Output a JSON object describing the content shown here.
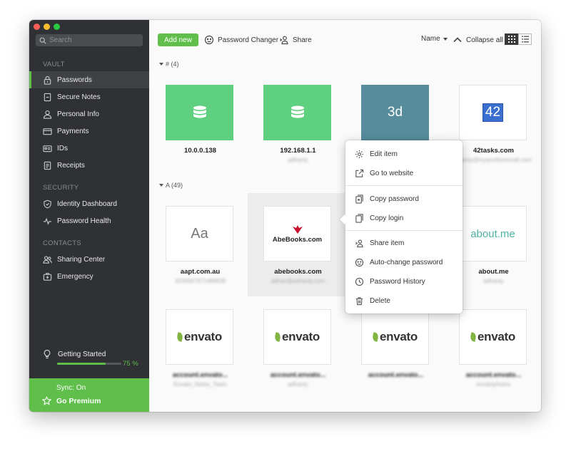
{
  "colors": {
    "accent": "#5fbf4a",
    "sidebar": "#2f3134",
    "tile_green": "#5fcf80",
    "tile_teal": "#568c9b",
    "tile_blue": "#3a6fd0",
    "about_me": "#4fb3a4",
    "abebooks_red": "#c8102e"
  },
  "sidebar": {
    "search_placeholder": "Search",
    "vault_header": "VAULT",
    "vault_items": [
      {
        "label": "Passwords",
        "icon": "lock-icon"
      },
      {
        "label": "Secure Notes",
        "icon": "note-icon"
      },
      {
        "label": "Personal Info",
        "icon": "person-icon"
      },
      {
        "label": "Payments",
        "icon": "card-icon"
      },
      {
        "label": "IDs",
        "icon": "id-icon"
      },
      {
        "label": "Receipts",
        "icon": "receipt-icon"
      }
    ],
    "security_header": "SECURITY",
    "security_items": [
      {
        "label": "Identity Dashboard",
        "icon": "shield-icon"
      },
      {
        "label": "Password Health",
        "icon": "pulse-icon"
      }
    ],
    "contacts_header": "CONTACTS",
    "contacts_items": [
      {
        "label": "Sharing Center",
        "icon": "people-icon"
      },
      {
        "label": "Emergency",
        "icon": "first-aid-icon"
      }
    ],
    "getting_started": "Getting Started",
    "progress_percent": 75,
    "progress_label": "75 %",
    "sync_status": "Sync: On",
    "go_premium": "Go Premium"
  },
  "toolbar": {
    "add_new": "Add new",
    "password_changer": "Password Changer",
    "share": "Share",
    "sort": "Name",
    "collapse_all": "Collapse all"
  },
  "groups": [
    {
      "label": "# (4)"
    },
    {
      "label": "A (49)"
    }
  ],
  "cards_hash": [
    {
      "title": "10.0.0.138",
      "sub": ""
    },
    {
      "title": "192.168.1.1",
      "sub": "adhanty"
    },
    {
      "title": "",
      "sub": "",
      "logo": "3d"
    },
    {
      "title": "42tasks.com",
      "sub": "adanty@myanotheremail.com",
      "logo": "42"
    }
  ],
  "cards_a": [
    {
      "title": "aapt.com.au",
      "sub": "3234567871488839",
      "logo": "Aa"
    },
    {
      "title": "abebooks.com",
      "sub": "adhan@adhanty.com",
      "logo": "AbeBooks.com"
    },
    {
      "title": "",
      "sub": ""
    },
    {
      "title": "about.me",
      "sub": "adhanty",
      "logo": "about.me"
    }
  ],
  "cards_envato": [
    {
      "title": "account.envato...",
      "sub": "Envato_Notes_Team",
      "logo": "envato"
    },
    {
      "title": "account.envato...",
      "sub": "adhanty",
      "logo": "envato"
    },
    {
      "title": "account.envato...",
      "sub": "",
      "logo": "envato"
    },
    {
      "title": "account.envato...",
      "sub": "envatophotos",
      "logo": "envato"
    }
  ],
  "float_more": "···",
  "context_menu": [
    {
      "label": "Edit item",
      "icon": "gear-icon"
    },
    {
      "label": "Go to website",
      "icon": "external-link-icon"
    },
    {
      "label": "Copy password",
      "icon": "copy-password-icon"
    },
    {
      "label": "Copy login",
      "icon": "copy-icon"
    },
    {
      "label": "Share item",
      "icon": "share-icon"
    },
    {
      "label": "Auto-change password",
      "icon": "refresh-face-icon"
    },
    {
      "label": "Password History",
      "icon": "clock-icon"
    },
    {
      "label": "Delete",
      "icon": "trash-icon"
    }
  ]
}
